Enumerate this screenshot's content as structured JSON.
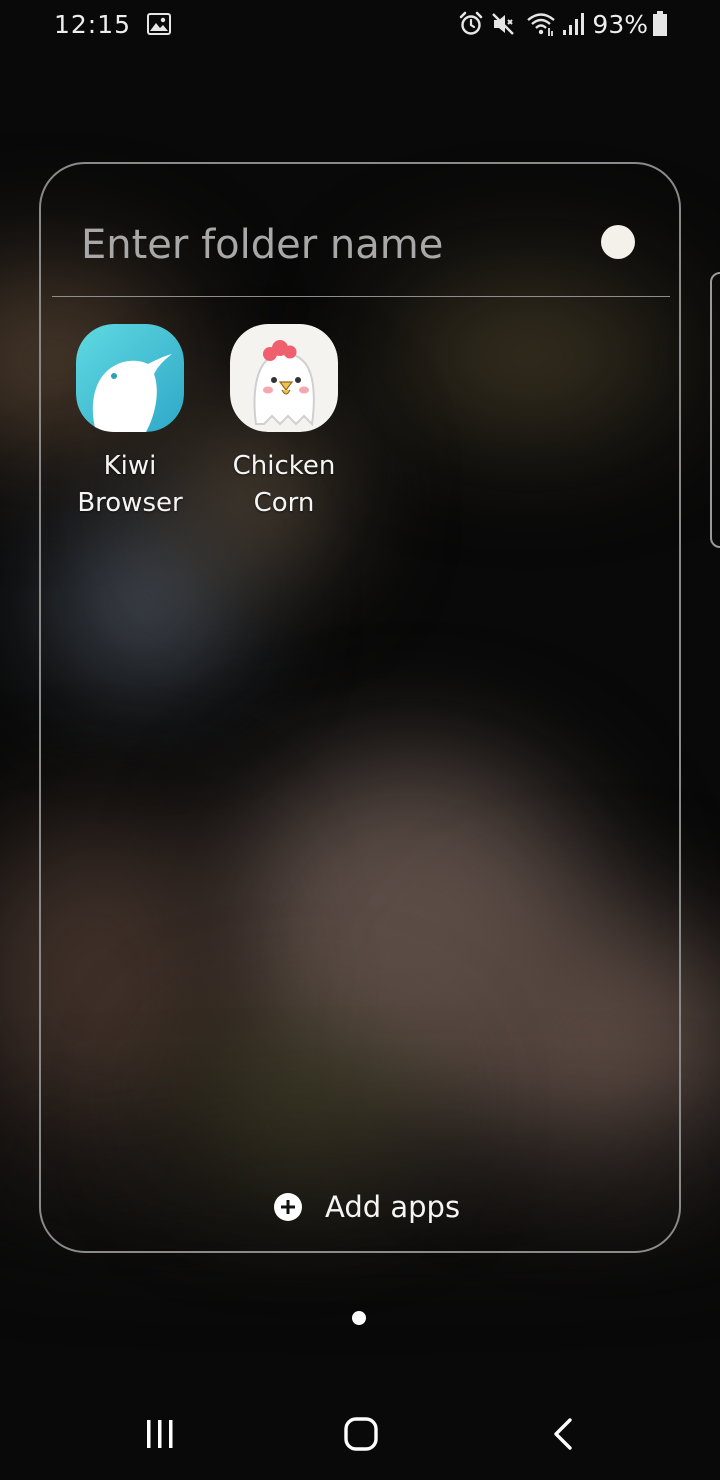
{
  "status_bar": {
    "time": "12:15",
    "battery_percent": "93%",
    "icons": [
      "image-notification-icon",
      "alarm-icon",
      "mute-icon",
      "wifi-icon",
      "signal-icon",
      "battery-icon"
    ]
  },
  "folder": {
    "name_placeholder": "Enter folder name",
    "name_value": "",
    "color_dot": "#f4f1ea",
    "apps": [
      {
        "label_line1": "Kiwi",
        "label_line2": "Browser",
        "icon": "kiwi-browser-icon"
      },
      {
        "label_line1": "Chicken",
        "label_line2": "Corn",
        "icon": "chicken-corn-icon"
      }
    ],
    "add_apps_label": "Add apps"
  },
  "nav_bar": {
    "buttons": [
      "recent-apps",
      "home",
      "back"
    ]
  },
  "colors": {
    "kiwi_teal": "#3ec6d6",
    "text": "#f5f5f5",
    "chicken_comb": "#ef5f6d"
  }
}
